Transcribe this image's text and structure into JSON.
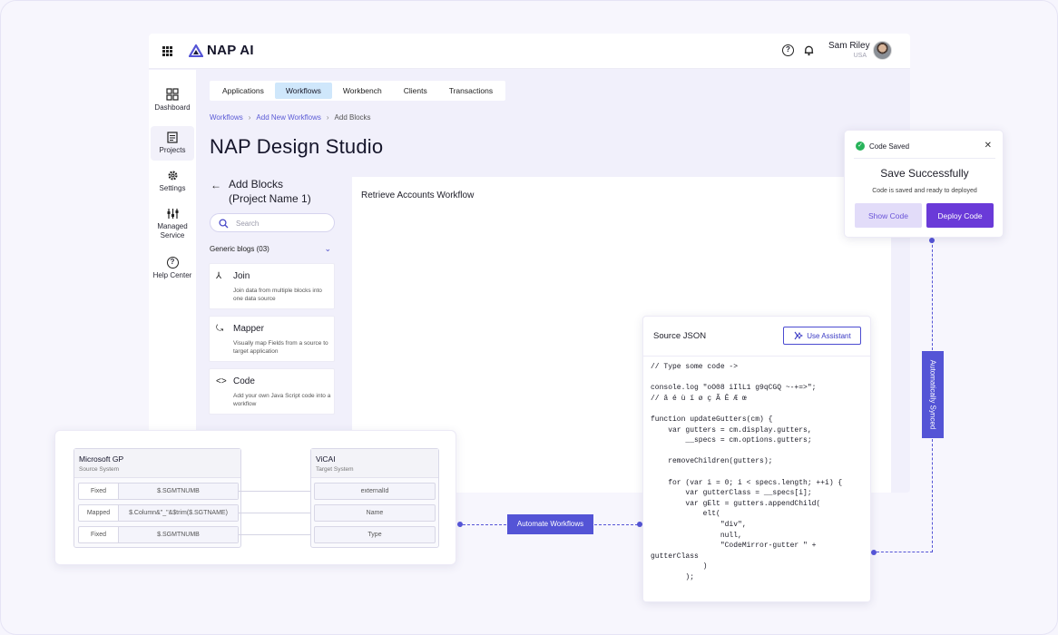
{
  "app": {
    "name": "NAP AI",
    "user": {
      "name": "Sam Riley",
      "location": "USA"
    }
  },
  "sidebar": {
    "items": [
      {
        "label": "Dashboard",
        "icon": "dashboard-icon"
      },
      {
        "label": "Projects",
        "icon": "projects-icon",
        "active": true
      },
      {
        "label": "Settings",
        "icon": "gear-icon"
      },
      {
        "label": "Managed Service",
        "icon": "managed-service-icon"
      },
      {
        "label": "Help Center",
        "icon": "help-icon"
      }
    ]
  },
  "tabs": [
    "Applications",
    "Workflows",
    "Workbench",
    "Clients",
    "Transactions"
  ],
  "active_tab": "Workflows",
  "breadcrumb": [
    "Workflows",
    "Add New Workflows",
    "Add Blocks"
  ],
  "page_title": "NAP Design Studio",
  "add_blocks": {
    "title_line1": "Add Blocks",
    "title_line2": "(Project Name 1)",
    "search_placeholder": "Search",
    "group_label": "Generic blogs (03)",
    "blocks": [
      {
        "name": "Join",
        "desc": "Join data from multiple blocks into one data source",
        "icon": "merge-icon"
      },
      {
        "name": "Mapper",
        "desc": "Visually map Fields from a source to target application",
        "icon": "split-icon"
      },
      {
        "name": "Code",
        "desc": "Add your own Java Script code into a workflow",
        "icon": "code-icon"
      }
    ]
  },
  "canvas_title": "Retrieve Accounts Workflow",
  "mapping": {
    "source": {
      "title": "Microsoft GP",
      "subtitle": "Source System"
    },
    "target": {
      "title": "ViCAI",
      "subtitle": "Target System"
    },
    "rows": [
      {
        "type": "Fixed",
        "value": "$.SGMTNUMB",
        "target": "externalId"
      },
      {
        "type": "Mapped",
        "value": "$.Column&\"_\"&$trim($.SGTNAME)",
        "target": "Name"
      },
      {
        "type": "Fixed",
        "value": "$.SGMTNUMB",
        "target": "Type"
      }
    ]
  },
  "automate_label": "Automate Workflows",
  "synced_label": "Automatically Synced",
  "json_card": {
    "title": "Source JSON",
    "assist_label": "Use Assistant",
    "code": "// Type some code ->\n\nconsole.log \"oO08 iIlL1 g9qCGQ ~-+=>\";\n// â é ù ï ø ç Ã Ē Æ œ\n\nfunction updateGutters(cm) {\n    var gutters = cm.display.gutters,\n        __specs = cm.options.gutters;\n\n    removeChildren(gutters);\n\n    for (var i = 0; i < specs.length; ++i) {\n        var gutterClass = __specs[i];\n        var gElt = gutters.appendChild(\n            elt(\n                \"div\",\n                null,\n                \"CodeMirror-gutter \" +\ngutterClass\n            )\n        );"
  },
  "toast": {
    "header": "Code Saved",
    "title": "Save Successfully",
    "subtitle": "Code is saved and ready to deployed",
    "show_label": "Show Code",
    "deploy_label": "Deploy Code"
  },
  "colors": {
    "accent": "#5454d6",
    "deploy": "#6a3ad8",
    "active_tab": "#cfe7fb",
    "success": "#27b35a"
  }
}
